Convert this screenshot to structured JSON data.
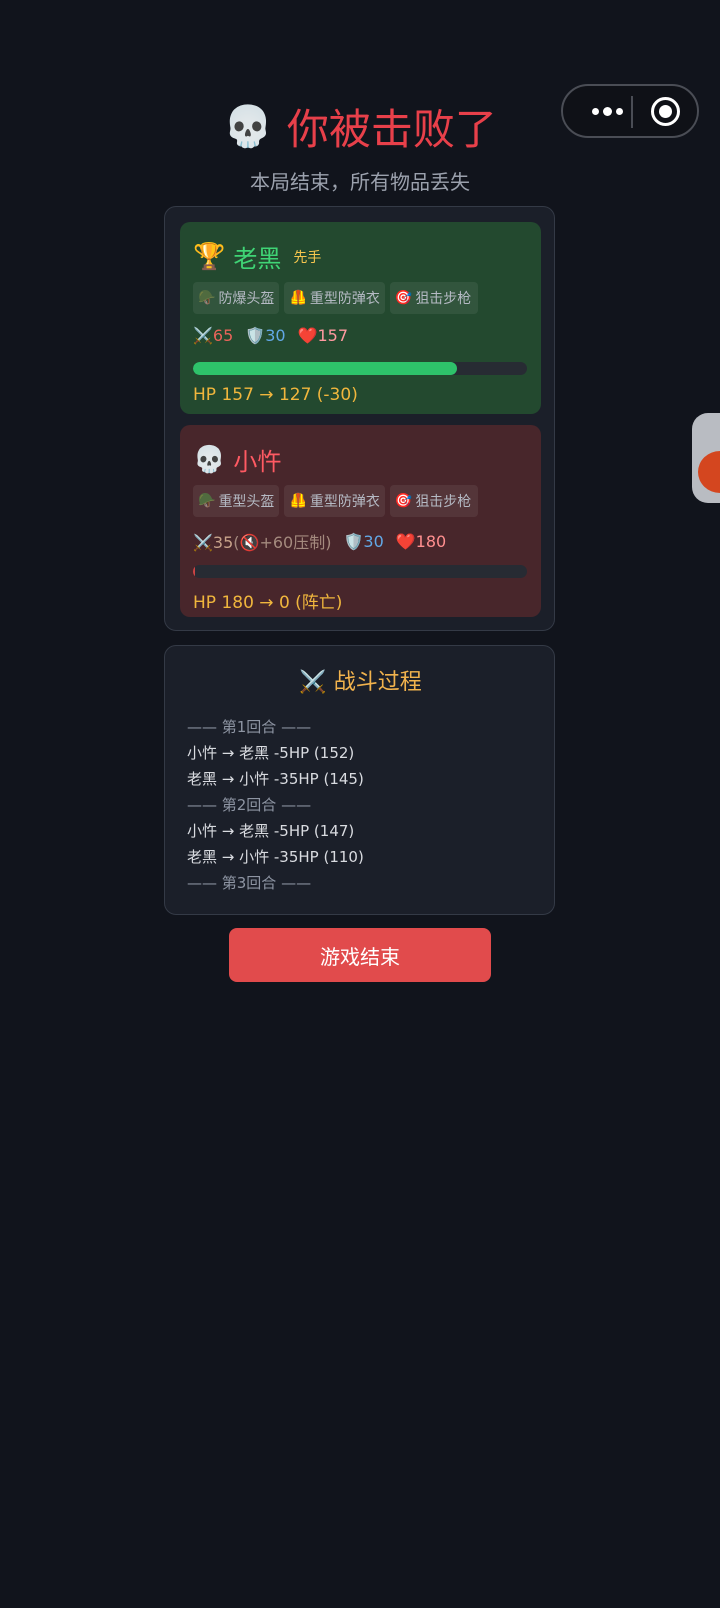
{
  "header": {
    "title": "你被击败了",
    "subtitle": "本局结束，所有物品丢失"
  },
  "winner": {
    "name": "老黑",
    "tag": "先手",
    "equipment": [
      {
        "icon": "🪖",
        "label": "防爆头盔"
      },
      {
        "icon": "🦺",
        "label": "重型防弹衣"
      },
      {
        "icon": "🎯",
        "label": "狙击步枪"
      }
    ],
    "attack": "65",
    "defense": "30",
    "hp": "157",
    "hp_fraction": 0.79,
    "hp_change": "HP 157 → 127 (-30)"
  },
  "loser": {
    "name": "小忤",
    "equipment": [
      {
        "icon": "🪖",
        "label": "重型头盔"
      },
      {
        "icon": "🦺",
        "label": "重型防弹衣"
      },
      {
        "icon": "🎯",
        "label": "狙击步枪"
      }
    ],
    "attack": "35",
    "attack_bonus": "(🔇+60压制)",
    "defense": "30",
    "hp": "180",
    "hp_fraction": 0,
    "hp_change": "HP 180 → 0 (阵亡)"
  },
  "battle_log": {
    "title": "战斗过程",
    "lines": [
      {
        "type": "round",
        "text": "—— 第1回合 ——"
      },
      {
        "type": "act",
        "text": "小忤 → 老黑 -5HP (152)"
      },
      {
        "type": "act",
        "text": "老黑 → 小忤 -35HP (145)"
      },
      {
        "type": "round",
        "text": "—— 第2回合 ——"
      },
      {
        "type": "act",
        "text": "小忤 → 老黑 -5HP (147)"
      },
      {
        "type": "act",
        "text": "老黑 → 小忤 -35HP (110)"
      },
      {
        "type": "round",
        "text": "—— 第3回合 ——"
      }
    ]
  },
  "end_button": "游戏结束",
  "icons": {
    "skull": "💀",
    "trophy": "🏆",
    "swords": "⚔️",
    "shield": "🛡️",
    "heart": "❤️"
  },
  "colors": {
    "background": "#11141c",
    "win_card": "#23492f",
    "lose_card": "#48262b",
    "accent_red": "#e8404a",
    "hp_bar": "#2ec26a",
    "gold": "#f0b63d"
  }
}
